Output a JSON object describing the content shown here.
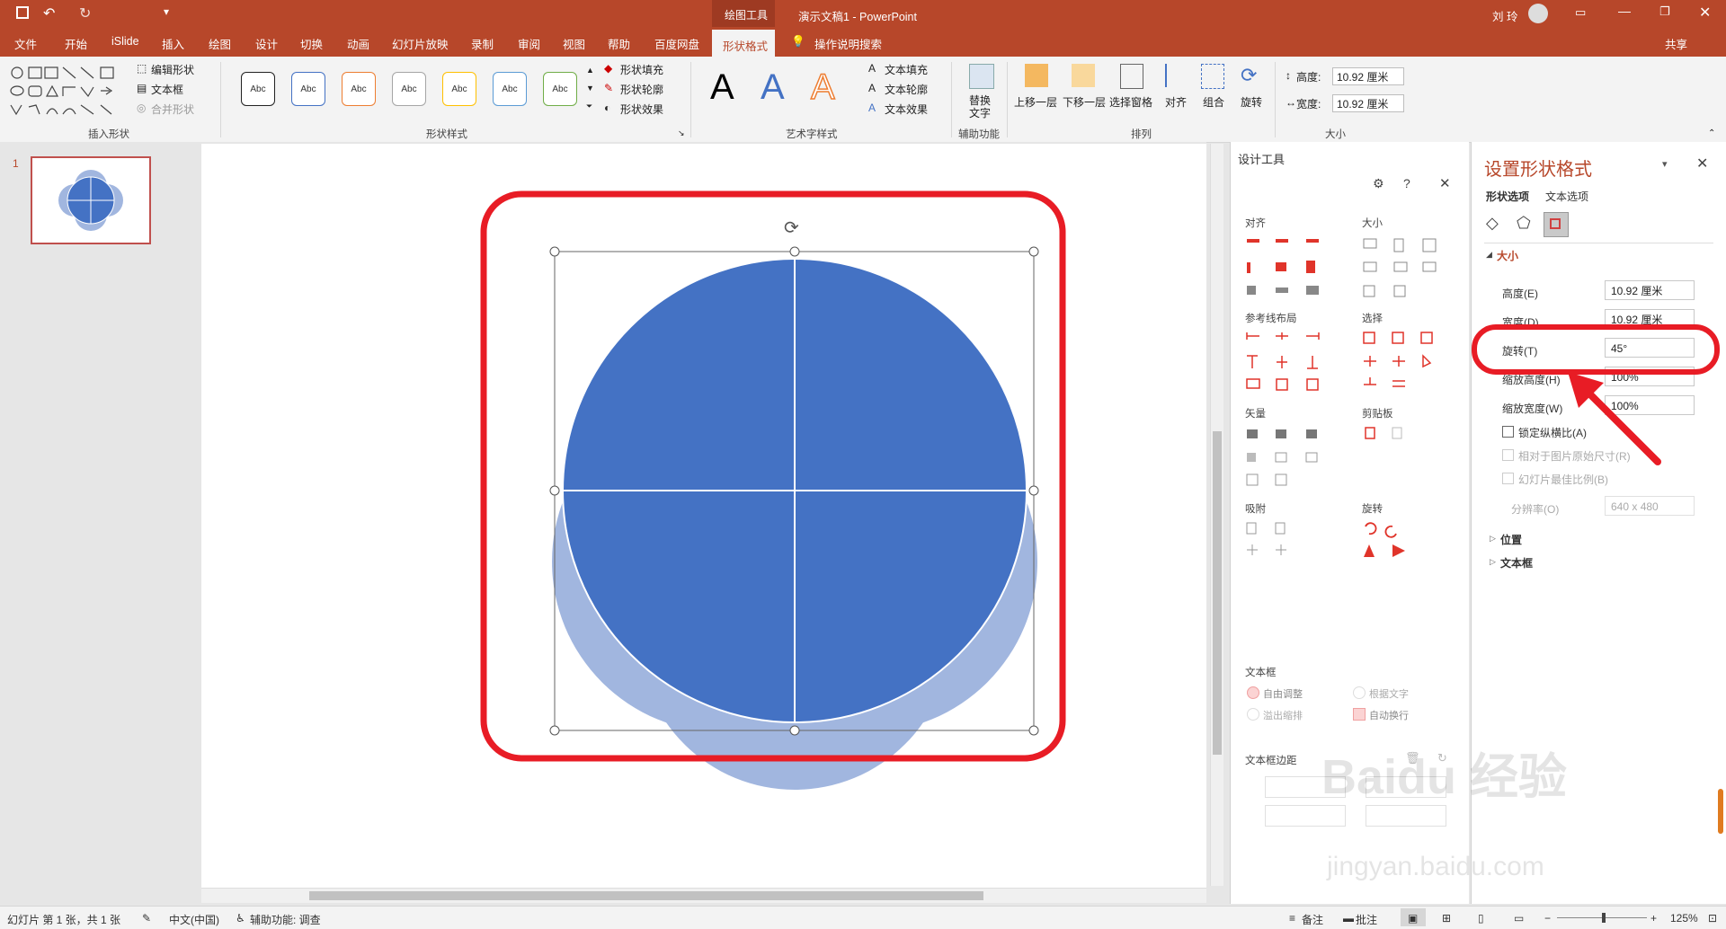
{
  "titlebar": {
    "contextual_tab_group": "绘图工具",
    "doc_title": "演示文稿1  -  PowerPoint",
    "user": "刘 玲"
  },
  "menu": {
    "tabs": [
      "文件",
      "开始",
      "iSlide",
      "插入",
      "绘图",
      "设计",
      "切换",
      "动画",
      "幻灯片放映",
      "录制",
      "审阅",
      "视图",
      "帮助",
      "百度网盘",
      "形状格式"
    ],
    "active_tab": "形状格式",
    "search": "操作说明搜索",
    "share": "共享"
  },
  "ribbon": {
    "insert_shapes": {
      "edit_shape": "编辑形状",
      "text_box": "文本框",
      "merge_shapes": "合并形状",
      "label": "插入形状"
    },
    "shape_styles": {
      "preset_text": "Abc",
      "preset_colors": [
        "#222222",
        "#4472c4",
        "#ed7d31",
        "#a5a5a5",
        "#ffc000",
        "#5b9bd5",
        "#70ad47"
      ],
      "fill": "形状填充",
      "outline": "形状轮廓",
      "effects": "形状效果",
      "label": "形状样式"
    },
    "wordart": {
      "letter": "A",
      "text_fill": "文本填充",
      "text_outline": "文本轮廓",
      "text_effects": "文本效果",
      "label": "艺术字样式"
    },
    "accessibility": {
      "alt_text_1": "替换",
      "alt_text_2": "文字",
      "label": "辅助功能"
    },
    "arrange": {
      "bring_forward": "上移一层",
      "send_backward": "下移一层",
      "selection_pane": "选择窗格",
      "align": "对齐",
      "group": "组合",
      "rotate": "旋转",
      "label": "排列"
    },
    "size": {
      "height_label": "高度:",
      "height_value": "10.92 厘米",
      "width_label": "宽度:",
      "width_value": "10.92 厘米",
      "label": "大小"
    }
  },
  "thumbnails": {
    "slide_number": "1"
  },
  "design_tools": {
    "title": "设计工具",
    "sections": {
      "align": "对齐",
      "size": "大小",
      "guide_layout": "参考线布局",
      "select": "选择",
      "vector": "矢量",
      "clipboard": "剪贴板",
      "snap": "吸附",
      "rotate": "旋转",
      "textbox": "文本框",
      "textbox_margin": "文本框边距"
    },
    "textbox_options": {
      "auto_fit": "自由调整",
      "fit_text": "根据文字",
      "shrink_overflow": "溢出缩排",
      "auto_wrap": "自动换行"
    }
  },
  "format_pane": {
    "title": "设置形状格式",
    "tab_shape": "形状选项",
    "tab_text": "文本选项",
    "section_size": "大小",
    "height_label": "高度(E)",
    "height_value": "10.92 厘米",
    "width_label": "宽度(D)",
    "width_value": "10.92 厘米",
    "rotation_label": "旋转(T)",
    "rotation_value": "45°",
    "scale_height_label": "缩放高度(H)",
    "scale_height_value": "100%",
    "scale_width_label": "缩放宽度(W)",
    "scale_width_value": "100%",
    "lock_aspect": "锁定纵横比(A)",
    "relative_original": "相对于图片原始尺寸(R)",
    "best_scale": "幻灯片最佳比例(B)",
    "resolution_label": "分辨率(O)",
    "resolution_value": "640 x 480",
    "section_position": "位置",
    "section_textbox": "文本框"
  },
  "statusbar": {
    "slide_info": "幻灯片 第 1 张，共 1 张",
    "language": "中文(中国)",
    "accessibility": "辅助功能: 调查",
    "notes": "备注",
    "comments": "批注",
    "zoom": "125%"
  },
  "watermark": {
    "line1": "Baidu 经验",
    "line2": "jingyan.baidu.com"
  },
  "colors": {
    "accent": "#b7472a",
    "shape_dark": "#4472c4",
    "shape_light": "#a1b6df",
    "highlight": "#e81c25"
  }
}
